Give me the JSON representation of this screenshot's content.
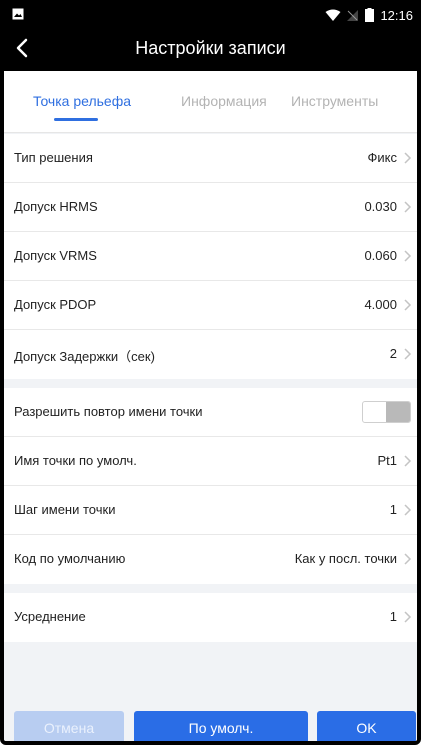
{
  "status_bar": {
    "time": "12:16"
  },
  "app_bar": {
    "title": "Настройки записи"
  },
  "tabs": [
    {
      "label": "Точка рельефа",
      "active": true
    },
    {
      "label": "Информация",
      "active": false
    },
    {
      "label": "Инструменты",
      "active": false
    }
  ],
  "settings": {
    "group1": [
      {
        "label": "Тип решения",
        "value": "Фикс"
      },
      {
        "label": "Допуск HRMS",
        "value": "0.030"
      },
      {
        "label": "Допуск VRMS",
        "value": "0.060"
      },
      {
        "label": "Допуск PDOP",
        "value": "4.000"
      },
      {
        "label": "Допуск Задержки（сек)",
        "value": "2"
      }
    ],
    "group2": [
      {
        "label": "Разрешить повтор имени точки",
        "toggle_on": false
      },
      {
        "label": "Имя точки по умолч.",
        "value": "Pt1"
      },
      {
        "label": "Шаг имени точки",
        "value": "1"
      },
      {
        "label": "Код по умолчанию",
        "value": "Как у посл. точки"
      }
    ],
    "group3": [
      {
        "label": "Усреднение",
        "value": "1"
      }
    ]
  },
  "buttons": {
    "cancel": "Отмена",
    "default": "По умолч.",
    "ok": "OK"
  },
  "colors": {
    "accent": "#2a6de6",
    "tab_active": "#2f6fe0",
    "background": "#f1f3f6"
  }
}
